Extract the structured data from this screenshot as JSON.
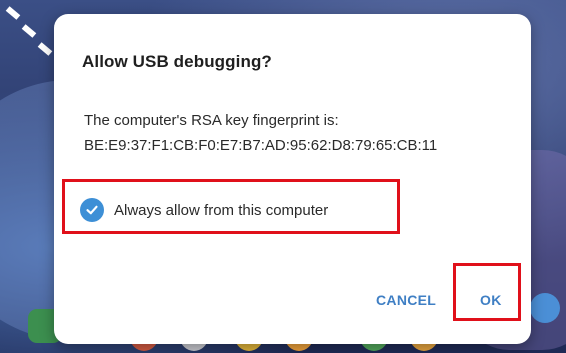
{
  "dialog": {
    "title": "Allow USB debugging?",
    "message_line1": "The computer's RSA key fingerprint is:",
    "fingerprint": "BE:E9:37:F1:CB:F0:E7:B7:AD:95:62:D8:79:65:CB:11",
    "checkbox": {
      "label": "Always allow from this computer",
      "checked": true
    },
    "buttons": {
      "cancel_label": "CANCEL",
      "ok_label": "OK"
    }
  },
  "colors": {
    "accent": "#3f7fc4",
    "checkbox": "#3d8fd6",
    "highlight": "#e0101a"
  },
  "icons": [
    "check-icon"
  ]
}
